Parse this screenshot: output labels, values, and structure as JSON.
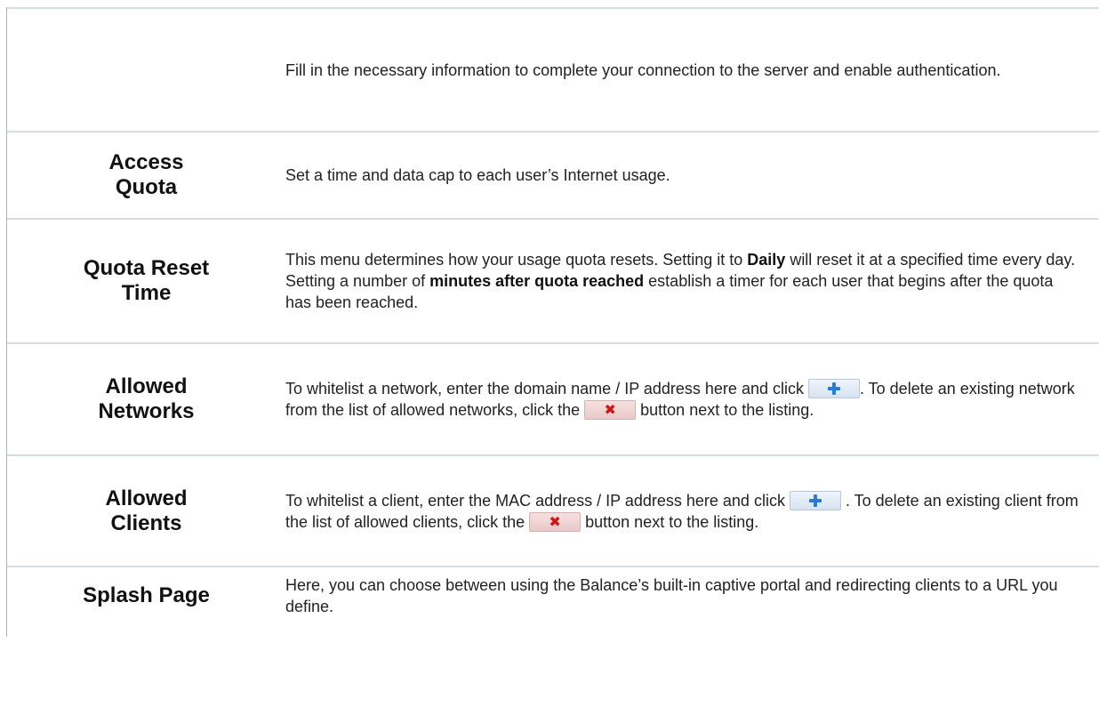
{
  "rows": [
    {
      "label": "",
      "desc": "Fill in the necessary information to complete your connection to the server and enable authentication."
    },
    {
      "label": "Access\nQuota",
      "desc": "Set a time and data cap to each user’s Internet usage."
    },
    {
      "label": "Quota Reset\nTime",
      "desc_parts": {
        "p1": "This menu determines how your usage quota resets. Setting it to ",
        "b1": "Daily",
        "p2": " will reset it at a specified time every day. Setting a number of ",
        "b2": "minutes after quota reached",
        "p3": " establish a timer for each user that begins after the quota has been reached."
      }
    },
    {
      "label": "Allowed\nNetworks",
      "desc_parts": {
        "p1": "To whitelist a network, enter the domain name / IP address here and click ",
        "p2": ". To delete an existing network from the list of allowed networks, click the ",
        "p3": " button next to the listing."
      }
    },
    {
      "label": "Allowed\nClients",
      "desc_parts": {
        "p1": "To whitelist a client, enter the MAC address / IP address here and click ",
        "p2": " . To delete an existing client from the list of allowed clients, click the ",
        "p3": " button next to the listing."
      }
    },
    {
      "label": "Splash Page",
      "desc": "Here, you can choose between using the Balance’s built-in captive portal and redirecting clients to a URL you define."
    }
  ],
  "icons": {
    "add": "plus-icon",
    "delete": "x-icon",
    "add_color": "#2a7ad6",
    "delete_color": "#d21414"
  }
}
